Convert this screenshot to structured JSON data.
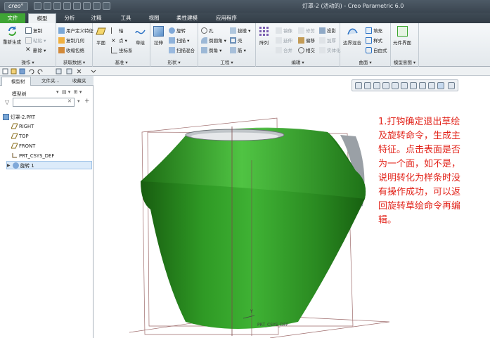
{
  "app": {
    "logo": "creo°",
    "title": "灯罩-2 (活动的) - Creo Parametric 6.0"
  },
  "menu_tabs": [
    "文件",
    "模型",
    "分析",
    "注释",
    "工具",
    "视图",
    "柔性建模",
    "应用程序"
  ],
  "ribbon": {
    "operations": {
      "label": "操作 ▾",
      "regen": "重新生成",
      "copy": "复制",
      "paste": "粘贴 ▾",
      "delete": "删除 ▾"
    },
    "get_data": {
      "label": "获取数据 ▾",
      "udf": "用户定义特征",
      "copy_geom": "复制几何",
      "shrinkwrap": "收缩包络"
    },
    "datum": {
      "label": "基准 ▾",
      "plane": "平面",
      "axis": "轴",
      "point": "点 ▾",
      "csys": "坐标系",
      "sketch": "草绘"
    },
    "shapes": {
      "label": "形状 ▾",
      "extrude": "拉伸",
      "revolve": "旋转",
      "sweep": "扫描 ▾",
      "swept_blend": "扫描混合"
    },
    "engineering": {
      "label": "工程 ▾",
      "hole": "孔",
      "round": "倒圆角 ▾",
      "chamfer": "倒角 ▾",
      "draft": "拔模 ▾",
      "shell": "壳",
      "rib": "筋 ▾"
    },
    "editing": {
      "label": "编辑 ▾",
      "pattern": "阵列",
      "mirror": "镜像",
      "extend": "延伸",
      "trim": "修剪",
      "merge": "合并",
      "offset": "偏移",
      "thicken": "加厚",
      "project": "投影",
      "intersect": "相交",
      "solidify": "实体化"
    },
    "surfaces": {
      "label": "曲面 ▾",
      "boundary_blend": "边界混合",
      "fill": "填充",
      "style": "样式",
      "freeform": "自由式"
    },
    "model_intent": {
      "label": "模型意图 ▾",
      "component_interface": "元件界面"
    }
  },
  "panel": {
    "tabs": [
      "模型树",
      "文件夹...",
      "收藏夹"
    ],
    "header": "模型树",
    "tree": [
      "灯罩-2.PRT",
      "RIGHT",
      "TOP",
      "FRONT",
      "PRT_CSYS_DEF",
      "旋转 1"
    ]
  },
  "viewport": {
    "csys_label": "PRT_CSYS_DEF",
    "axis_y": "Y"
  },
  "annotation": "1.打钩确定退出草绘及旋转命令，生成主特征。点击表面是否为一个面，如不是，说明转化为样条时没有操作成功，可以返回旋转草绘命令再编辑。",
  "colors": {
    "part_green": "#3aa62f",
    "annotation_red": "#e2241b",
    "file_tab": "#3fa535"
  }
}
